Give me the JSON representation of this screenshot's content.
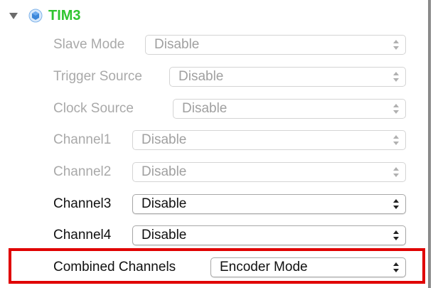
{
  "tree": {
    "node_label": "TIM3",
    "node_color": "#2fc52f"
  },
  "colors": {
    "disabled_text": "#a9a9a9",
    "enabled_text": "#111111",
    "highlight_border": "#e00000"
  },
  "rows": {
    "slave_mode": {
      "label": "Slave Mode",
      "value": "Disable"
    },
    "trigger_source": {
      "label": "Trigger Source",
      "value": "Disable"
    },
    "clock_source": {
      "label": "Clock Source",
      "value": "Disable"
    },
    "channel1": {
      "label": "Channel1",
      "value": "Disable"
    },
    "channel2": {
      "label": "Channel2",
      "value": "Disable"
    },
    "channel3": {
      "label": "Channel3",
      "value": "Disable"
    },
    "channel4": {
      "label": "Channel4",
      "value": "Disable"
    },
    "combined_channels": {
      "label": "Combined Channels",
      "value": "Encoder Mode"
    }
  }
}
